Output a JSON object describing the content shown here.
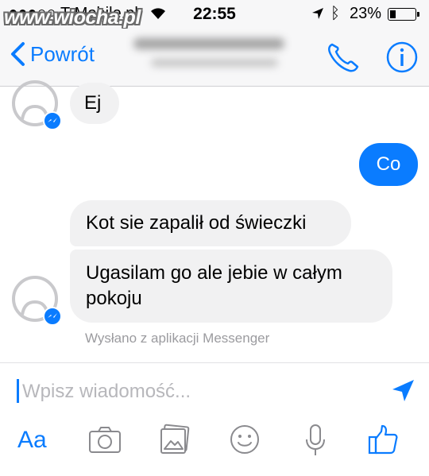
{
  "status_bar": {
    "carrier": "T-Mobile.pl",
    "time": "22:55",
    "battery": "23%",
    "battery_level": 0.23,
    "watermark": "www.wiocha.pl"
  },
  "nav": {
    "back_label": "Powrót"
  },
  "messages": [
    {
      "from": "other",
      "text": "Ej"
    },
    {
      "from": "me",
      "text": "Co"
    },
    {
      "from": "other",
      "text": "Kot sie zapalił od świeczki"
    },
    {
      "from": "other",
      "text": "Ugasilam go ale jebie w całym pokoju"
    }
  ],
  "sent_note": "Wysłano z aplikacji Messenger",
  "composer": {
    "placeholder": "Wpisz wiadomość..."
  },
  "toolbar": {
    "text_style_label": "Aa"
  },
  "colors": {
    "accent": "#0a7cff",
    "bubble_incoming": "#f1f1f2",
    "bar_background": "#f7f7f8"
  }
}
